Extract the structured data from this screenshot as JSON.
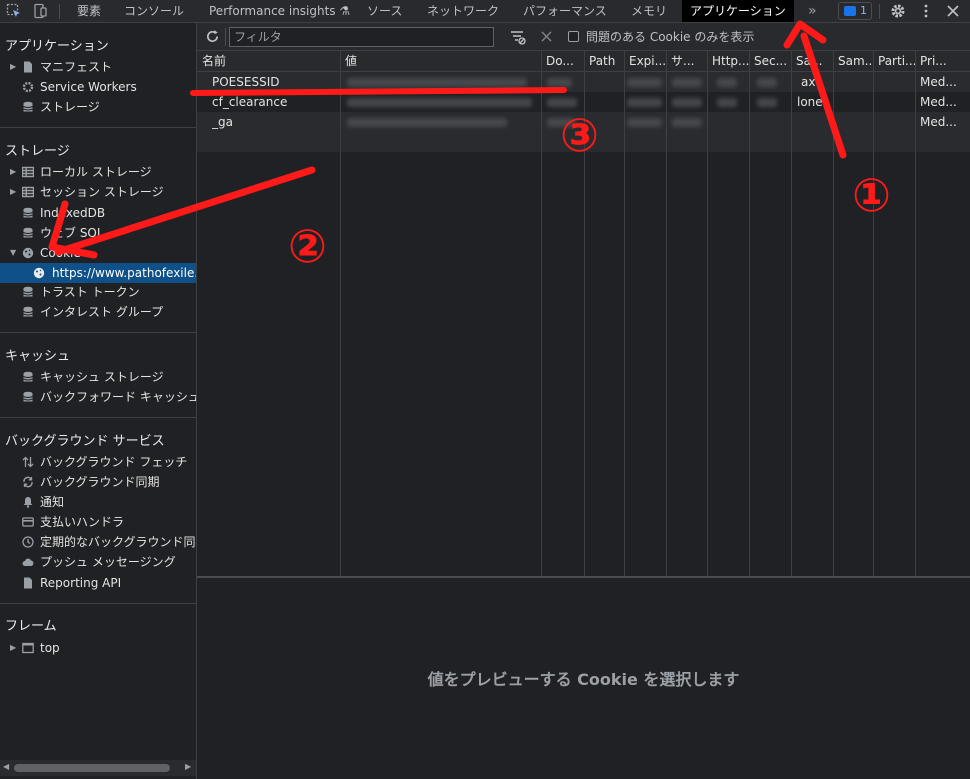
{
  "topbar": {
    "tabs": [
      {
        "label": "要素"
      },
      {
        "label": "コンソール"
      },
      {
        "label": "Performance insights ⚗"
      },
      {
        "label": "ソース"
      },
      {
        "label": "ネットワーク"
      },
      {
        "label": "パフォーマンス"
      },
      {
        "label": "メモリ"
      },
      {
        "label": "アプリケーション",
        "active": true
      }
    ],
    "more": "»",
    "issues_count": "1"
  },
  "sidebar": {
    "application": {
      "title": "アプリケーション",
      "items": [
        {
          "label": "マニフェスト"
        },
        {
          "label": "Service Workers"
        },
        {
          "label": "ストレージ"
        }
      ]
    },
    "storage": {
      "title": "ストレージ",
      "items": [
        {
          "label": "ローカル ストレージ"
        },
        {
          "label": "セッション ストレージ"
        },
        {
          "label": "IndexedDB"
        },
        {
          "label": "ウェブ SQL"
        },
        {
          "label": "Cookie"
        },
        {
          "label": "https://www.pathofexile.com"
        },
        {
          "label": "トラスト トークン"
        },
        {
          "label": "インタレスト グループ"
        }
      ]
    },
    "cache": {
      "title": "キャッシュ",
      "items": [
        {
          "label": "キャッシュ ストレージ"
        },
        {
          "label": "バックフォワード キャッシュ"
        }
      ]
    },
    "background": {
      "title": "バックグラウンド サービス",
      "items": [
        {
          "label": "バックグラウンド フェッチ"
        },
        {
          "label": "バックグラウンド同期"
        },
        {
          "label": "通知"
        },
        {
          "label": "支払いハンドラ"
        },
        {
          "label": "定期的なバックグラウンド同期"
        },
        {
          "label": "プッシュ メッセージング"
        },
        {
          "label": "Reporting API"
        }
      ]
    },
    "frames": {
      "title": "フレーム",
      "items": [
        {
          "label": "top"
        }
      ]
    }
  },
  "toolbar": {
    "filter_placeholder": "フィルタ",
    "only_issues_label": "問題のある Cookie のみを表示"
  },
  "table": {
    "columns": [
      "名前",
      "値",
      "Do...",
      "Path",
      "Expi...",
      "サ...",
      "Http...",
      "Sec...",
      "Sa...",
      "Sam...",
      "Parti...",
      "Pri..."
    ],
    "rows": [
      {
        "name": "POESESSID",
        "samesite": "ax",
        "priority": "Med..."
      },
      {
        "name": "cf_clearance",
        "samesite": "lone",
        "priority": "Med..."
      },
      {
        "name": "_ga",
        "samesite": "",
        "priority": "Med..."
      }
    ]
  },
  "preview": {
    "message": "値をプレビューする Cookie を選択します"
  },
  "annotations": {
    "numbers": [
      "①",
      "②",
      "③"
    ],
    "color": "#ff1a1a"
  }
}
